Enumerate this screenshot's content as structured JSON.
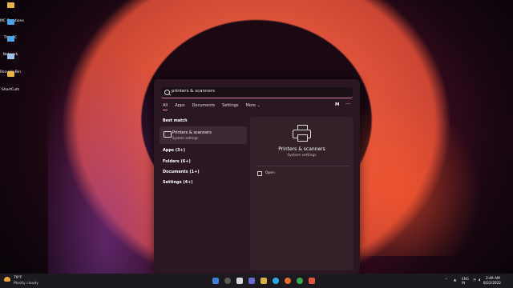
{
  "desktop": {
    "icons": [
      {
        "label": "MC Creations",
        "color": "#e8b643"
      },
      {
        "label": "This PC",
        "color": "#4aa3e8"
      },
      {
        "label": "Network",
        "color": "#4aa3e8"
      },
      {
        "label": "Recycle Bin",
        "color": "#9fc6ea"
      },
      {
        "label": "ShortCuts",
        "color": "#e8b643"
      }
    ]
  },
  "start_menu": {
    "search": {
      "value": "printers & scanners",
      "icon": "search-icon"
    },
    "tabs": [
      "All",
      "Apps",
      "Documents",
      "Settings",
      "More ⌄"
    ],
    "active_tab": "All",
    "avatar": "M",
    "more_options": "···",
    "best_match": {
      "heading": "Best match",
      "title": "Printers & scanners",
      "subtitle": "System settings",
      "icon": "printer-icon"
    },
    "categories": [
      "Apps (3+)",
      "Folders (6+)",
      "Documents (1+)",
      "Settings (4+)"
    ],
    "preview": {
      "title": "Printers & scanners",
      "subtitle": "System settings",
      "action": "Open",
      "icon": "printer-icon"
    }
  },
  "taskbar": {
    "weather": {
      "temp": "79°F",
      "desc": "Mostly cloudy",
      "icon": "weather-icon"
    },
    "lang_top": "ENG",
    "lang_bottom": "IN",
    "clock": {
      "time": "2:49 AM",
      "date": "8/22/2022"
    },
    "app_colors": [
      "#3f7fd8",
      "#5a5a5a",
      "#d8d8d8",
      "#6a6acf",
      "#d9b23a",
      "#2da8e8",
      "#e86a2d",
      "#39a852",
      "#e0563b"
    ]
  },
  "colors": {
    "accent": "#e89bb6",
    "menu_bg": "#2a1721"
  }
}
